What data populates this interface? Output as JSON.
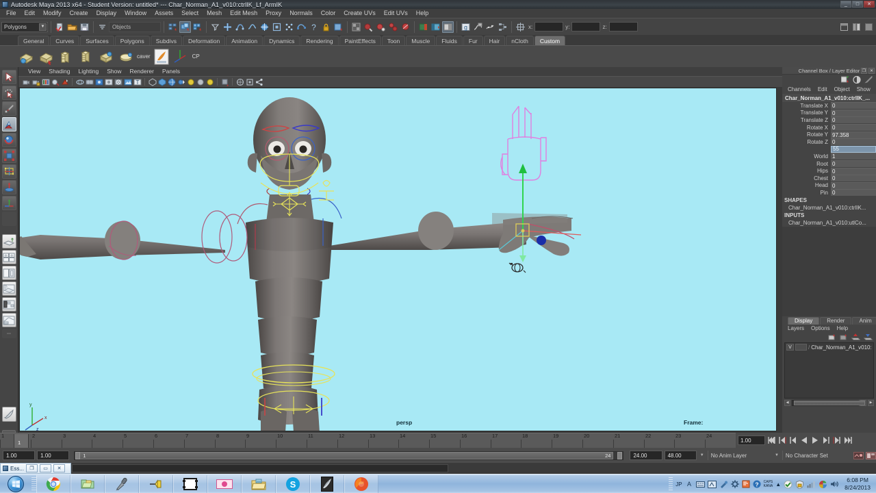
{
  "window": {
    "title": "Autodesk Maya 2013 x64 - Student Version: untitled*   ---   Char_Norman_A1_v010:ctrlIK_Lf_ArmIK",
    "minimize": "_",
    "maximize": "□",
    "close": "✕"
  },
  "menubar": [
    "File",
    "Edit",
    "Modify",
    "Create",
    "Display",
    "Window",
    "Assets",
    "Select",
    "Mesh",
    "Edit Mesh",
    "Proxy",
    "Normals",
    "Color",
    "Create UVs",
    "Edit UVs",
    "Help"
  ],
  "statusline": {
    "mode_menu": "Polygons",
    "selection_mask": "Objects",
    "coord_labels": [
      "x:",
      "y:",
      "z:"
    ],
    "coord_values": [
      "",
      "",
      ""
    ]
  },
  "shelf": {
    "tabs": [
      "General",
      "Curves",
      "Surfaces",
      "Polygons",
      "Subdivs",
      "Deformation",
      "Animation",
      "Dynamics",
      "Rendering",
      "PaintEffects",
      "Toon",
      "Muscle",
      "Fluids",
      "Fur",
      "Hair",
      "nCloth",
      "Custom"
    ],
    "active_tab": "Custom",
    "items": [
      {
        "name": "shelf-icon-1",
        "label": ""
      },
      {
        "name": "shelf-icon-2",
        "label": ""
      },
      {
        "name": "shelf-icon-3",
        "label": ""
      },
      {
        "name": "shelf-icon-4",
        "label": ""
      },
      {
        "name": "shelf-icon-5",
        "label": ""
      },
      {
        "name": "shelf-icon-6",
        "label": ""
      },
      {
        "name": "shelf-text-caver",
        "label": "caver"
      },
      {
        "name": "shelf-icon-maya",
        "label": ""
      },
      {
        "name": "shelf-text-cp",
        "label": "CP"
      }
    ]
  },
  "toolbox": {
    "items": [
      {
        "name": "select-tool",
        "icon": "arrow-cursor-icon",
        "selected": false
      },
      {
        "name": "lasso-select-tool",
        "icon": "lasso-icon",
        "selected": false
      },
      {
        "name": "paint-select-tool",
        "icon": "paint-brush-icon",
        "selected": false
      },
      {
        "name": "move-tool",
        "icon": "move-arrows-icon",
        "selected": true
      },
      {
        "name": "rotate-tool",
        "icon": "rotate-ring-icon",
        "selected": false
      },
      {
        "name": "scale-tool",
        "icon": "scale-box-icon",
        "selected": false
      },
      {
        "name": "universal-manipulator-tool",
        "icon": "universal-manip-icon",
        "selected": false
      },
      {
        "name": "soft-modification-tool",
        "icon": "soft-mod-icon",
        "selected": false
      },
      {
        "name": "show-manipulator-tool",
        "icon": "show-manip-icon",
        "selected": false
      },
      {
        "name": "last-tool-used",
        "icon": "blank-icon",
        "selected": false
      }
    ],
    "layouts": [
      "single-perspective-layout",
      "four-view-layout",
      "two-pane-side-layout",
      "outliner-persp-layout",
      "hypergraph-persp-layout",
      "persp-graph-layout"
    ],
    "paint_effects": "paint-effects-icon"
  },
  "viewport_menu": [
    "View",
    "Shading",
    "Lighting",
    "Show",
    "Renderer",
    "Panels"
  ],
  "viewport": {
    "camera_label": "persp",
    "frame_label": "Frame:",
    "frame_value": "",
    "axis_labels": [
      "y",
      "x",
      "z"
    ],
    "background_color": "#a8e9f5",
    "mesh_color": "#6e6a6a"
  },
  "channel_box": {
    "title": "Channel Box / Layer Editor",
    "menus": [
      "Channels",
      "Edit",
      "Object",
      "Show"
    ],
    "node_name": "Char_Norman_A1_v010:ctrlIK_...",
    "channels": [
      {
        "name": "Translate X",
        "value": "0",
        "selected": false
      },
      {
        "name": "Translate Y",
        "value": "0",
        "selected": false
      },
      {
        "name": "Translate Z",
        "value": "0",
        "selected": false
      },
      {
        "name": "Rotate X",
        "value": "0",
        "selected": false
      },
      {
        "name": "Rotate Y",
        "value": "97.358",
        "selected": false
      },
      {
        "name": "Rotate Z",
        "value": "0",
        "selected": false
      },
      {
        "name": "",
        "value": "55",
        "selected": true
      },
      {
        "name": "World",
        "value": "1",
        "selected": false
      },
      {
        "name": "Root",
        "value": "0",
        "selected": false
      },
      {
        "name": "Hips",
        "value": "0",
        "selected": false
      },
      {
        "name": "Chest",
        "value": "0",
        "selected": false
      },
      {
        "name": "Head",
        "value": "0",
        "selected": false
      },
      {
        "name": "Pin",
        "value": "0",
        "selected": false
      }
    ],
    "shapes_header": "SHAPES",
    "shapes_item": "Char_Norman_A1_v010:ctrlIK...",
    "inputs_header": "INPUTS",
    "inputs_item": "Char_Norman_A1_v010:utlCo..."
  },
  "layer_editor": {
    "tabs": [
      "Display",
      "Render",
      "Anim"
    ],
    "active_tab": "Display",
    "menus": [
      "Layers",
      "Options",
      "Help"
    ],
    "layers": [
      {
        "visibility": "V",
        "shading": "",
        "name": "Char_Norman_A1_v010:"
      }
    ]
  },
  "timeline": {
    "start": 1,
    "end": 24,
    "current_frame": "1",
    "ticks": [
      1,
      2,
      3,
      4,
      5,
      6,
      7,
      8,
      9,
      10,
      11,
      12,
      13,
      14,
      15,
      16,
      17,
      18,
      19,
      20,
      21,
      22,
      23,
      24
    ]
  },
  "playback": {
    "frame_field": "1.00",
    "buttons": [
      "go-to-start-icon",
      "step-back-key-icon",
      "step-back-frame-icon",
      "play-backwards-icon",
      "play-forwards-icon",
      "step-forward-frame-icon",
      "step-forward-key-icon",
      "go-to-end-icon"
    ]
  },
  "range_slider": {
    "anim_start": "1.00",
    "anim_end": "1.00",
    "range_start": "1",
    "range_end": "24",
    "playback_end": "24.00",
    "anim_end_field": "48.00",
    "anim_layer": "No Anim Layer",
    "character_set": "No Character Set"
  },
  "minimized_window": {
    "label": "Ess...",
    "restore": "❐",
    "minimize": "▭",
    "close": "✕"
  },
  "taskbar": {
    "start": "windows-orb-icon",
    "apps": [
      {
        "name": "taskbar-chrome",
        "icon": "chrome-icon"
      },
      {
        "name": "taskbar-folder",
        "icon": "folder-stack-icon"
      },
      {
        "name": "taskbar-mic",
        "icon": "microphone-icon"
      },
      {
        "name": "taskbar-pin",
        "icon": "pushpin-icon"
      },
      {
        "name": "taskbar-film",
        "icon": "film-frame-icon"
      },
      {
        "name": "taskbar-record",
        "icon": "record-pink-icon"
      },
      {
        "name": "taskbar-explorer",
        "icon": "explorer-folder-icon"
      },
      {
        "name": "taskbar-skype",
        "icon": "skype-icon"
      },
      {
        "name": "taskbar-maya",
        "icon": "maya-icon"
      },
      {
        "name": "taskbar-firefox",
        "icon": "firefox-icon"
      }
    ],
    "tray_items": [
      "JP",
      "A-input-icon",
      "keyboard-icon",
      "ime-pad-icon",
      "tools-icon",
      "gear-icon",
      "doc-icon",
      "help-icon"
    ],
    "caps_label": "CAPS",
    "kana_label": "KANA",
    "tray_icons": [
      "action-center-icon",
      "security-icon",
      "network-icon",
      "battery-icon",
      "volume-icon"
    ],
    "time": "6:08 PM",
    "date": "8/24/2013"
  }
}
